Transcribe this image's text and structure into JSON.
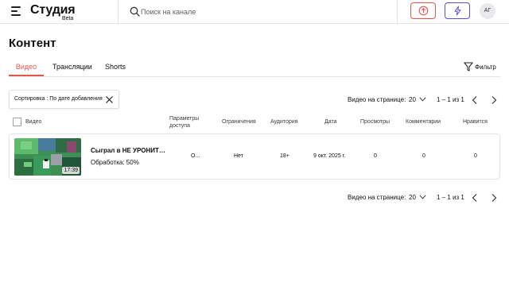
{
  "header": {
    "logo_title": "Студия",
    "logo_badge": "Beta",
    "search_placeholder": "Поиск на канале",
    "avatar_initials": "АГ",
    "upload_color": "#e05a4a",
    "live_color": "#5b4fd1"
  },
  "page": {
    "title": "Контент"
  },
  "tabs": [
    {
      "label": "Видео",
      "active": true
    },
    {
      "label": "Трансляции",
      "active": false
    },
    {
      "label": "Shorts",
      "active": false
    }
  ],
  "filter": {
    "label": "Фильтр"
  },
  "sort_chip": {
    "label": "Сортировка : По дате добавления"
  },
  "pagination": {
    "per_page_label": "Видео на странице:",
    "per_page_value": "20",
    "range": "1 – 1 из 1"
  },
  "table": {
    "columns": {
      "video": "Видео",
      "access": "Параметры доступа",
      "restrictions": "Ограничения",
      "audience": "Аудитория",
      "date": "Дата",
      "views": "Просмотры",
      "comments": "Комментарии",
      "likes": "Нравится"
    },
    "rows": [
      {
        "title": "Сыграл в НЕ УРОНИТЬ...",
        "status": "Обработка: 50%",
        "duration": "17:39",
        "access": "О...",
        "restrictions": "Нет",
        "audience": "18+",
        "date": "9 окт. 2025 г.",
        "views": "0",
        "comments": "0",
        "likes": "0"
      }
    ]
  },
  "colors": {
    "accent": "#e05a4a",
    "live_accent": "#5b4fd1"
  }
}
